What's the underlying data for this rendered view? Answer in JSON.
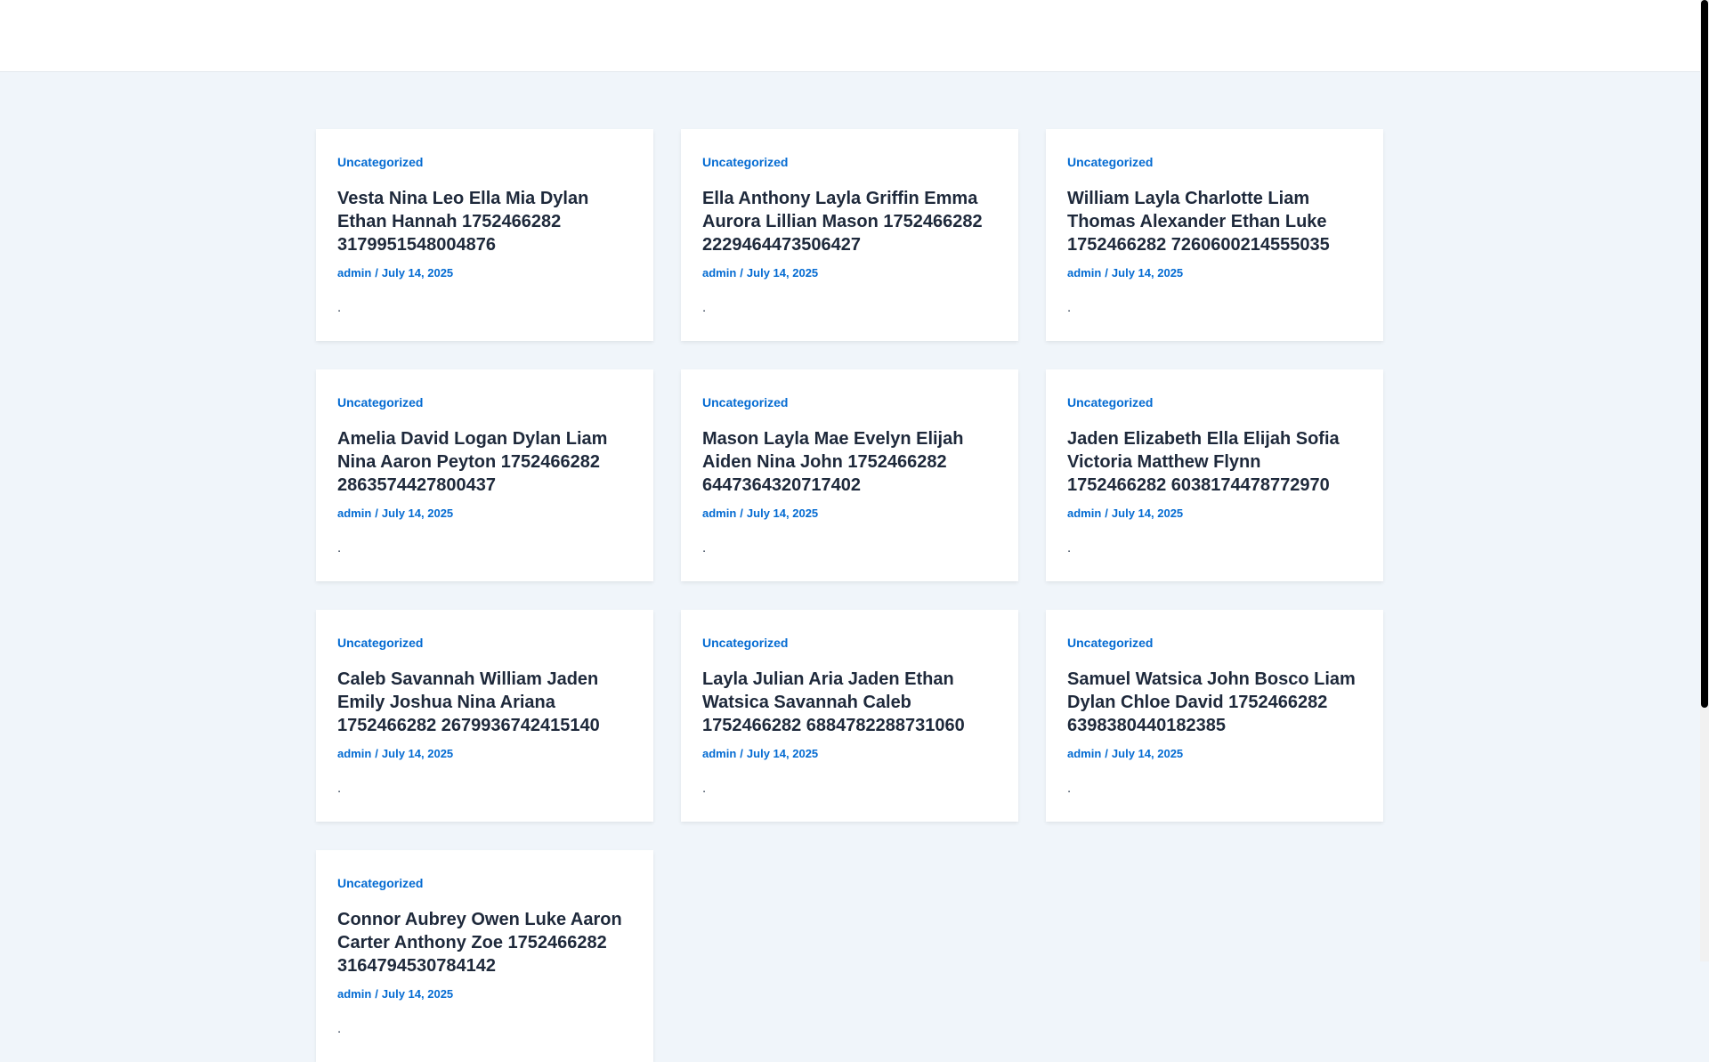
{
  "posts": [
    {
      "category": "Uncategorized",
      "title": "Vesta Nina Leo Ella Mia Dylan Ethan Hannah 1752466282 3179951548004876",
      "author": "admin",
      "separator": "/",
      "date": "July 14, 2025",
      "excerpt": "."
    },
    {
      "category": "Uncategorized",
      "title": "Ella Anthony Layla Griffin Emma Aurora Lillian Mason 1752466282 2229464473506427",
      "author": "admin",
      "separator": "/",
      "date": "July 14, 2025",
      "excerpt": "."
    },
    {
      "category": "Uncategorized",
      "title": "William Layla Charlotte Liam Thomas Alexander Ethan Luke 1752466282 7260600214555035",
      "author": "admin",
      "separator": "/",
      "date": "July 14, 2025",
      "excerpt": "."
    },
    {
      "category": "Uncategorized",
      "title": "Amelia David Logan Dylan Liam Nina Aaron Peyton 1752466282 2863574427800437",
      "author": "admin",
      "separator": "/",
      "date": "July 14, 2025",
      "excerpt": "."
    },
    {
      "category": "Uncategorized",
      "title": "Mason Layla Mae Evelyn Elijah Aiden Nina John 1752466282 6447364320717402",
      "author": "admin",
      "separator": "/",
      "date": "July 14, 2025",
      "excerpt": "."
    },
    {
      "category": "Uncategorized",
      "title": "Jaden Elizabeth Ella Elijah Sofia Victoria Matthew Flynn 1752466282 6038174478772970",
      "author": "admin",
      "separator": "/",
      "date": "July 14, 2025",
      "excerpt": "."
    },
    {
      "category": "Uncategorized",
      "title": "Caleb Savannah William Jaden Emily Joshua Nina Ariana 1752466282 2679936742415140",
      "author": "admin",
      "separator": "/",
      "date": "July 14, 2025",
      "excerpt": "."
    },
    {
      "category": "Uncategorized",
      "title": "Layla Julian Aria Jaden Ethan Watsica Savannah Caleb 1752466282 6884782288731060",
      "author": "admin",
      "separator": "/",
      "date": "July 14, 2025",
      "excerpt": "."
    },
    {
      "category": "Uncategorized",
      "title": "Samuel Watsica John Bosco Liam Dylan Chloe David 1752466282 6398380440182385",
      "author": "admin",
      "separator": "/",
      "date": "July 14, 2025",
      "excerpt": "."
    },
    {
      "category": "Uncategorized",
      "title": "Connor Aubrey Owen Luke Aaron Carter Anthony Zoe 1752466282 3164794530784142",
      "author": "admin",
      "separator": "/",
      "date": "July 14, 2025",
      "excerpt": "."
    }
  ],
  "colors": {
    "accent": "#046bd2",
    "title": "#1e293b",
    "background": "#f0f5fa",
    "card": "#ffffff"
  }
}
